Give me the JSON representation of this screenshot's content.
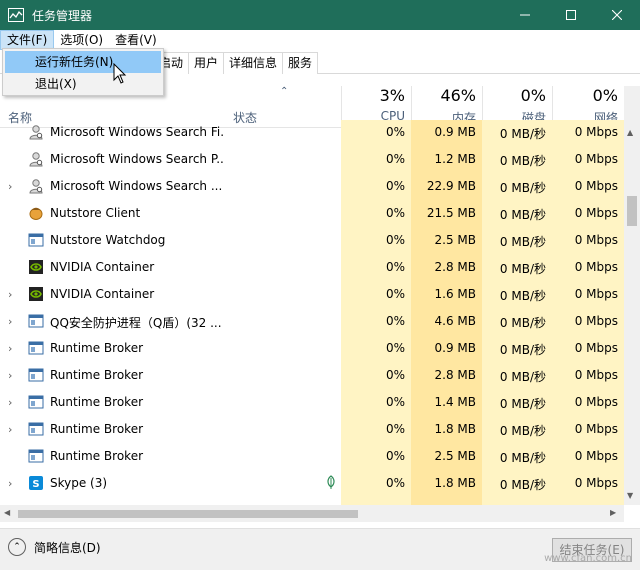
{
  "window": {
    "title": "任务管理器",
    "accent": "#1f6e5a"
  },
  "menu": [
    "文件(F)",
    "选项(O)",
    "查看(V)"
  ],
  "dropdown": [
    "运行新任务(N)",
    "退出(X)"
  ],
  "tabs": [
    "启动",
    "用户",
    "详细信息",
    "服务"
  ],
  "header": {
    "name": "名称",
    "status": "状态",
    "cpu_pct": "3%",
    "cpu": "CPU",
    "mem_pct": "46%",
    "mem": "内存",
    "disk_pct": "0%",
    "disk": "磁盘",
    "net_pct": "0%",
    "net": "网络"
  },
  "rows": [
    {
      "name": "Microsoft Windows Search Fi...",
      "icon": "search-user-icon",
      "expandable": false,
      "leaf": false,
      "cpu": "0%",
      "mem": "0.9 MB",
      "disk": "0 MB/秒",
      "net": "0 Mbps"
    },
    {
      "name": "Microsoft Windows Search P...",
      "icon": "search-user-icon",
      "expandable": false,
      "leaf": false,
      "cpu": "0%",
      "mem": "1.2 MB",
      "disk": "0 MB/秒",
      "net": "0 Mbps"
    },
    {
      "name": "Microsoft Windows Search ...",
      "icon": "search-user-icon",
      "expandable": true,
      "leaf": false,
      "cpu": "0%",
      "mem": "22.9 MB",
      "disk": "0 MB/秒",
      "net": "0 Mbps"
    },
    {
      "name": "Nutstore Client",
      "icon": "nutstore-icon",
      "expandable": false,
      "leaf": false,
      "cpu": "0%",
      "mem": "21.5 MB",
      "disk": "0 MB/秒",
      "net": "0 Mbps"
    },
    {
      "name": "Nutstore Watchdog",
      "icon": "window-app-icon",
      "expandable": false,
      "leaf": false,
      "cpu": "0%",
      "mem": "2.5 MB",
      "disk": "0 MB/秒",
      "net": "0 Mbps"
    },
    {
      "name": "NVIDIA Container",
      "icon": "nvidia-icon",
      "expandable": false,
      "leaf": false,
      "cpu": "0%",
      "mem": "2.8 MB",
      "disk": "0 MB/秒",
      "net": "0 Mbps"
    },
    {
      "name": "NVIDIA Container",
      "icon": "nvidia-icon",
      "expandable": true,
      "leaf": false,
      "cpu": "0%",
      "mem": "1.6 MB",
      "disk": "0 MB/秒",
      "net": "0 Mbps"
    },
    {
      "name": "QQ安全防护进程（Q盾）(32 ...",
      "icon": "window-app-icon",
      "expandable": true,
      "leaf": false,
      "cpu": "0%",
      "mem": "4.6 MB",
      "disk": "0 MB/秒",
      "net": "0 Mbps"
    },
    {
      "name": "Runtime Broker",
      "icon": "window-app-icon",
      "expandable": true,
      "leaf": false,
      "cpu": "0%",
      "mem": "0.9 MB",
      "disk": "0 MB/秒",
      "net": "0 Mbps"
    },
    {
      "name": "Runtime Broker",
      "icon": "window-app-icon",
      "expandable": true,
      "leaf": false,
      "cpu": "0%",
      "mem": "2.8 MB",
      "disk": "0 MB/秒",
      "net": "0 Mbps"
    },
    {
      "name": "Runtime Broker",
      "icon": "window-app-icon",
      "expandable": true,
      "leaf": false,
      "cpu": "0%",
      "mem": "1.4 MB",
      "disk": "0 MB/秒",
      "net": "0 Mbps"
    },
    {
      "name": "Runtime Broker",
      "icon": "window-app-icon",
      "expandable": true,
      "leaf": false,
      "cpu": "0%",
      "mem": "1.8 MB",
      "disk": "0 MB/秒",
      "net": "0 Mbps"
    },
    {
      "name": "Runtime Broker",
      "icon": "window-app-icon",
      "expandable": false,
      "leaf": false,
      "cpu": "0%",
      "mem": "2.5 MB",
      "disk": "0 MB/秒",
      "net": "0 Mbps"
    },
    {
      "name": "Skype (3)",
      "icon": "skype-icon",
      "expandable": true,
      "leaf": true,
      "cpu": "0%",
      "mem": "1.8 MB",
      "disk": "0 MB/秒",
      "net": "0 Mbps"
    }
  ],
  "footer": {
    "less": "简略信息(D)",
    "end_task": "结束任务(E)",
    "watermark": "www.cfan.com.cn"
  }
}
